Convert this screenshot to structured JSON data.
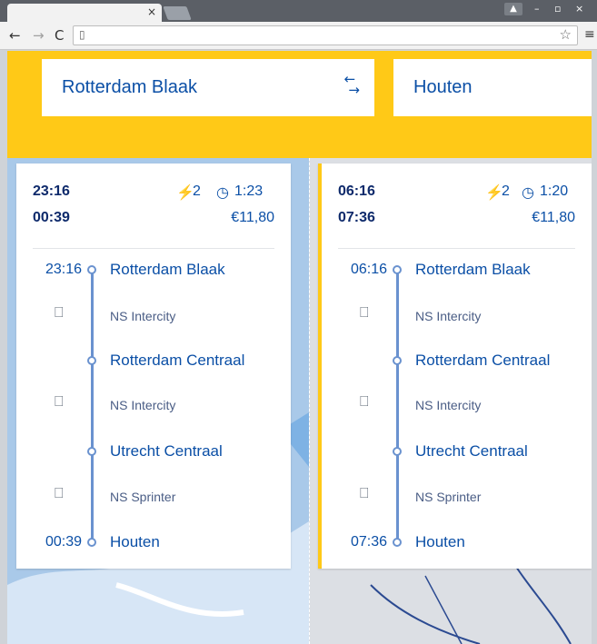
{
  "browser": {
    "tab_close": "×",
    "menu": "≡",
    "back": "←",
    "forward": "→",
    "reload": "C",
    "url": "",
    "win_user": "▲",
    "win_min": "–",
    "win_max": "▫",
    "win_close": "×"
  },
  "search": {
    "from": "Rotterdam Blaak",
    "to": "Houten",
    "swap_icon": "⇆"
  },
  "trips": [
    {
      "departure": "23:16",
      "arrival": "00:39",
      "transfers": "2",
      "duration": "1:23",
      "price": "€11,80",
      "stops": [
        {
          "time": "23:16",
          "name": "Rotterdam Blaak"
        },
        {
          "name": "Rotterdam Centraal"
        },
        {
          "name": "Utrecht Centraal"
        },
        {
          "time": "00:39",
          "name": "Houten"
        }
      ],
      "legs": [
        "NS Intercity",
        "NS Intercity",
        "NS Sprinter"
      ]
    },
    {
      "departure": "06:16",
      "arrival": "07:36",
      "transfers": "2",
      "duration": "1:20",
      "price": "€11,80",
      "stops": [
        {
          "time": "06:16",
          "name": "Rotterdam Blaak"
        },
        {
          "name": "Rotterdam Centraal"
        },
        {
          "name": "Utrecht Centraal"
        },
        {
          "time": "07:36",
          "name": "Houten"
        }
      ],
      "legs": [
        "NS Intercity",
        "NS Intercity",
        "NS Sprinter"
      ]
    }
  ],
  "icons": {
    "transfer": "⇄",
    "clock": "◷",
    "train": "🚆"
  },
  "colors": {
    "brand_yellow": "#ffc917",
    "ns_blue": "#0b4fa6",
    "route_line": "#6a92cf"
  }
}
